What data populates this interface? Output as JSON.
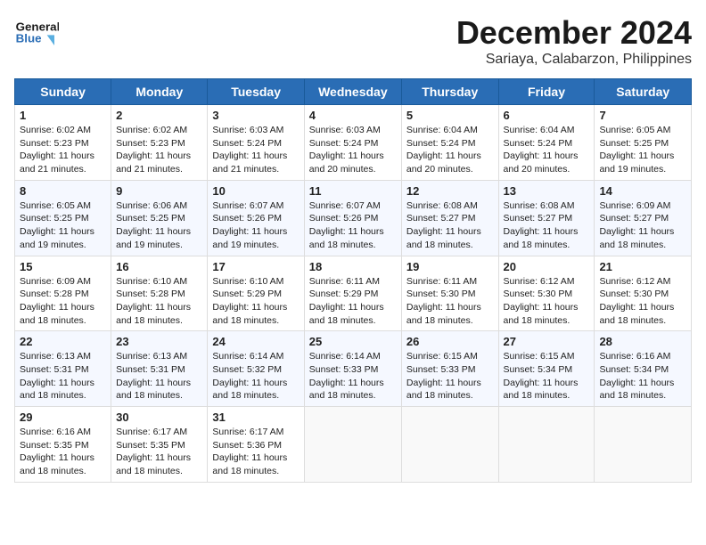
{
  "header": {
    "logo_line1": "General",
    "logo_line2": "Blue",
    "title": "December 2024",
    "subtitle": "Sariaya, Calabarzon, Philippines"
  },
  "calendar": {
    "days_of_week": [
      "Sunday",
      "Monday",
      "Tuesday",
      "Wednesday",
      "Thursday",
      "Friday",
      "Saturday"
    ],
    "weeks": [
      [
        {
          "day": "1",
          "info": "Sunrise: 6:02 AM\nSunset: 5:23 PM\nDaylight: 11 hours\nand 21 minutes."
        },
        {
          "day": "2",
          "info": "Sunrise: 6:02 AM\nSunset: 5:23 PM\nDaylight: 11 hours\nand 21 minutes."
        },
        {
          "day": "3",
          "info": "Sunrise: 6:03 AM\nSunset: 5:24 PM\nDaylight: 11 hours\nand 21 minutes."
        },
        {
          "day": "4",
          "info": "Sunrise: 6:03 AM\nSunset: 5:24 PM\nDaylight: 11 hours\nand 20 minutes."
        },
        {
          "day": "5",
          "info": "Sunrise: 6:04 AM\nSunset: 5:24 PM\nDaylight: 11 hours\nand 20 minutes."
        },
        {
          "day": "6",
          "info": "Sunrise: 6:04 AM\nSunset: 5:24 PM\nDaylight: 11 hours\nand 20 minutes."
        },
        {
          "day": "7",
          "info": "Sunrise: 6:05 AM\nSunset: 5:25 PM\nDaylight: 11 hours\nand 19 minutes."
        }
      ],
      [
        {
          "day": "8",
          "info": "Sunrise: 6:05 AM\nSunset: 5:25 PM\nDaylight: 11 hours\nand 19 minutes."
        },
        {
          "day": "9",
          "info": "Sunrise: 6:06 AM\nSunset: 5:25 PM\nDaylight: 11 hours\nand 19 minutes."
        },
        {
          "day": "10",
          "info": "Sunrise: 6:07 AM\nSunset: 5:26 PM\nDaylight: 11 hours\nand 19 minutes."
        },
        {
          "day": "11",
          "info": "Sunrise: 6:07 AM\nSunset: 5:26 PM\nDaylight: 11 hours\nand 18 minutes."
        },
        {
          "day": "12",
          "info": "Sunrise: 6:08 AM\nSunset: 5:27 PM\nDaylight: 11 hours\nand 18 minutes."
        },
        {
          "day": "13",
          "info": "Sunrise: 6:08 AM\nSunset: 5:27 PM\nDaylight: 11 hours\nand 18 minutes."
        },
        {
          "day": "14",
          "info": "Sunrise: 6:09 AM\nSunset: 5:27 PM\nDaylight: 11 hours\nand 18 minutes."
        }
      ],
      [
        {
          "day": "15",
          "info": "Sunrise: 6:09 AM\nSunset: 5:28 PM\nDaylight: 11 hours\nand 18 minutes."
        },
        {
          "day": "16",
          "info": "Sunrise: 6:10 AM\nSunset: 5:28 PM\nDaylight: 11 hours\nand 18 minutes."
        },
        {
          "day": "17",
          "info": "Sunrise: 6:10 AM\nSunset: 5:29 PM\nDaylight: 11 hours\nand 18 minutes."
        },
        {
          "day": "18",
          "info": "Sunrise: 6:11 AM\nSunset: 5:29 PM\nDaylight: 11 hours\nand 18 minutes."
        },
        {
          "day": "19",
          "info": "Sunrise: 6:11 AM\nSunset: 5:30 PM\nDaylight: 11 hours\nand 18 minutes."
        },
        {
          "day": "20",
          "info": "Sunrise: 6:12 AM\nSunset: 5:30 PM\nDaylight: 11 hours\nand 18 minutes."
        },
        {
          "day": "21",
          "info": "Sunrise: 6:12 AM\nSunset: 5:30 PM\nDaylight: 11 hours\nand 18 minutes."
        }
      ],
      [
        {
          "day": "22",
          "info": "Sunrise: 6:13 AM\nSunset: 5:31 PM\nDaylight: 11 hours\nand 18 minutes."
        },
        {
          "day": "23",
          "info": "Sunrise: 6:13 AM\nSunset: 5:31 PM\nDaylight: 11 hours\nand 18 minutes."
        },
        {
          "day": "24",
          "info": "Sunrise: 6:14 AM\nSunset: 5:32 PM\nDaylight: 11 hours\nand 18 minutes."
        },
        {
          "day": "25",
          "info": "Sunrise: 6:14 AM\nSunset: 5:33 PM\nDaylight: 11 hours\nand 18 minutes."
        },
        {
          "day": "26",
          "info": "Sunrise: 6:15 AM\nSunset: 5:33 PM\nDaylight: 11 hours\nand 18 minutes."
        },
        {
          "day": "27",
          "info": "Sunrise: 6:15 AM\nSunset: 5:34 PM\nDaylight: 11 hours\nand 18 minutes."
        },
        {
          "day": "28",
          "info": "Sunrise: 6:16 AM\nSunset: 5:34 PM\nDaylight: 11 hours\nand 18 minutes."
        }
      ],
      [
        {
          "day": "29",
          "info": "Sunrise: 6:16 AM\nSunset: 5:35 PM\nDaylight: 11 hours\nand 18 minutes."
        },
        {
          "day": "30",
          "info": "Sunrise: 6:17 AM\nSunset: 5:35 PM\nDaylight: 11 hours\nand 18 minutes."
        },
        {
          "day": "31",
          "info": "Sunrise: 6:17 AM\nSunset: 5:36 PM\nDaylight: 11 hours\nand 18 minutes."
        },
        null,
        null,
        null,
        null
      ]
    ]
  }
}
